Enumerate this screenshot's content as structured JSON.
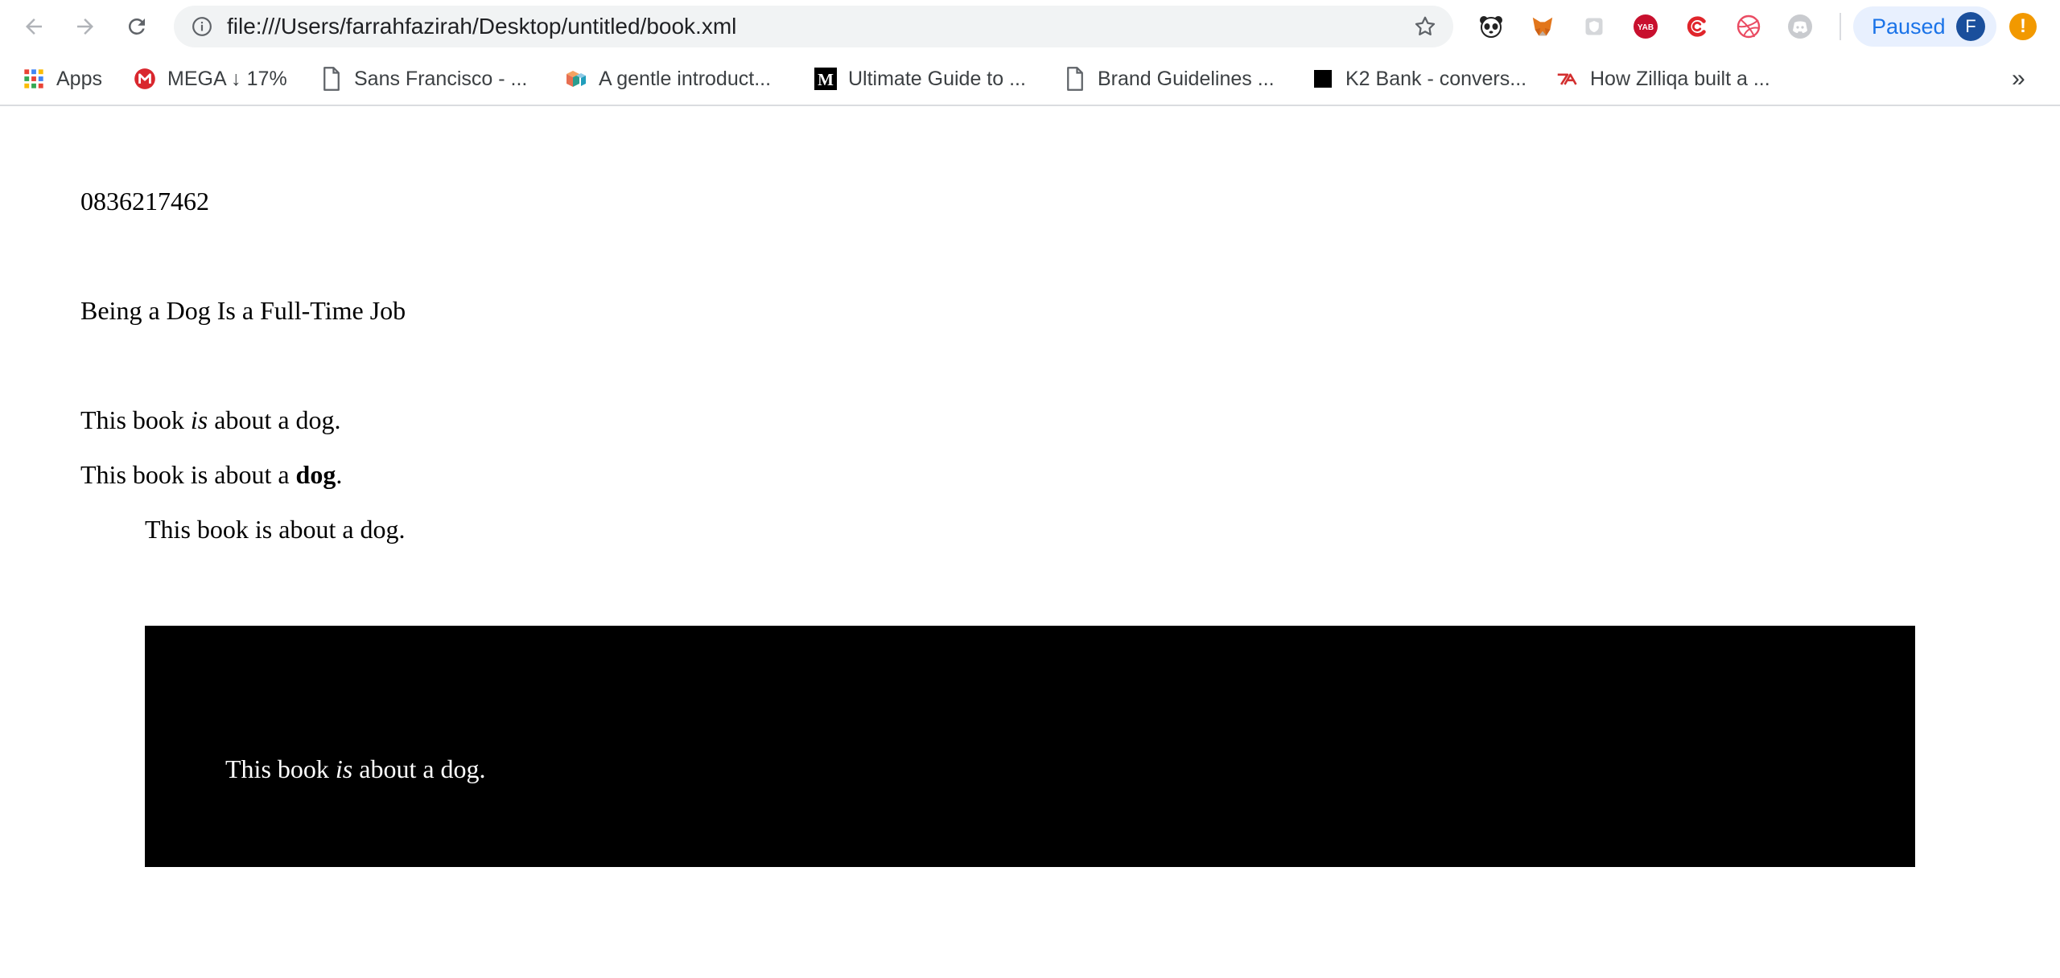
{
  "browser": {
    "url": "file:///Users/farrahfazirah/Desktop/untitled/book.xml",
    "profile": {
      "label": "Paused",
      "initial": "F"
    },
    "alert_symbol": "!",
    "extensions": [
      "panda-extension-icon",
      "metamask-fox-icon",
      "shield-extension-icon",
      "yab-extension-icon",
      "red-c-extension-icon",
      "dribbble-extension-icon",
      "discord-extension-icon"
    ]
  },
  "bookmarks": {
    "items": [
      {
        "label": "Apps",
        "icon": "apps-grid-icon"
      },
      {
        "label": "MEGA ↓ 17%",
        "icon": "mega-icon"
      },
      {
        "label": "Sans Francisco - ...",
        "icon": "page-icon"
      },
      {
        "label": "A gentle introduct...",
        "icon": "cube-icon"
      },
      {
        "label": "Ultimate Guide to ...",
        "icon": "medium-icon"
      },
      {
        "label": "Brand Guidelines ...",
        "icon": "page-icon"
      },
      {
        "label": "K2 Bank - convers...",
        "icon": "black-square-icon"
      },
      {
        "label": "How Zilliqa built a ...",
        "icon": "red-logo-icon"
      }
    ],
    "more": "»"
  },
  "document": {
    "isbn": "0836217462",
    "title": "Being a Dog Is a Full-Time Job",
    "line1": {
      "before": "This book ",
      "emphasis": "is",
      "after": " about a dog."
    },
    "line2": {
      "before": "This book is about a ",
      "strong": "dog",
      "after": "."
    },
    "line3": "This book is about a dog.",
    "box": {
      "before": "This book ",
      "emphasis": "is",
      "after": " about a dog."
    }
  },
  "colors": {
    "accent": "#1a73e8",
    "box_background": "#000000",
    "box_text": "#ffffff"
  }
}
